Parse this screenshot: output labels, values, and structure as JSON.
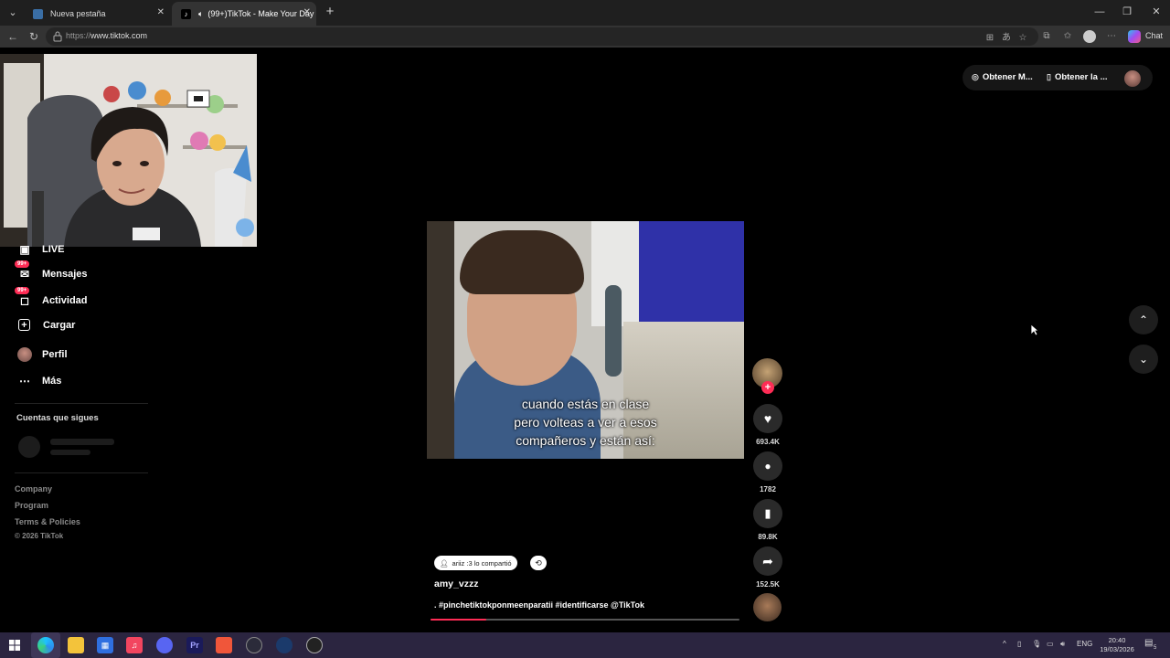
{
  "browser": {
    "tabs": [
      {
        "title": "Nueva pestaña",
        "active": false
      },
      {
        "title": "(99+)TikTok - Make Your Day",
        "active": true
      }
    ],
    "url_protocol": "https://",
    "url_host": "www.tiktok.com",
    "chat_label": "Chat"
  },
  "header": {
    "get_coins_label": "Obtener M...",
    "get_app_label": "Obtener la ..."
  },
  "sidebar": {
    "items": [
      {
        "label": "LIVE",
        "icon": "live-icon"
      },
      {
        "label": "Mensajes",
        "icon": "messages-icon",
        "badge": "99+"
      },
      {
        "label": "Actividad",
        "icon": "activity-icon",
        "badge": "99+"
      },
      {
        "label": "Cargar",
        "icon": "upload-icon"
      },
      {
        "label": "Perfil",
        "icon": "profile-icon"
      },
      {
        "label": "Más",
        "icon": "more-icon"
      }
    ],
    "following_title": "Cuentas que sigues",
    "footer": [
      "Company",
      "Program",
      "Terms & Policies"
    ],
    "copyright": "© 2026 TikTok"
  },
  "video": {
    "caption_lines": [
      "cuando estás en clase",
      "pero volteas a ver a esos",
      "compañeros y están así:"
    ],
    "repost_text": "ariiz :3 lo compartió",
    "author": "amy_vzzz",
    "description": ". #pinchetiktokponmeenparatii #identificarse @TikTok",
    "progress": 0.18,
    "likes": "693.4K",
    "comments": "1782",
    "saves": "89.8K",
    "shares": "152.5K"
  },
  "taskbar": {
    "language": "ENG",
    "time": "20:40",
    "date": "19/03/2026",
    "notifications": "5"
  },
  "colors": {
    "accent": "#fe2c55",
    "background": "#000000",
    "taskbar": "#2b2540"
  }
}
